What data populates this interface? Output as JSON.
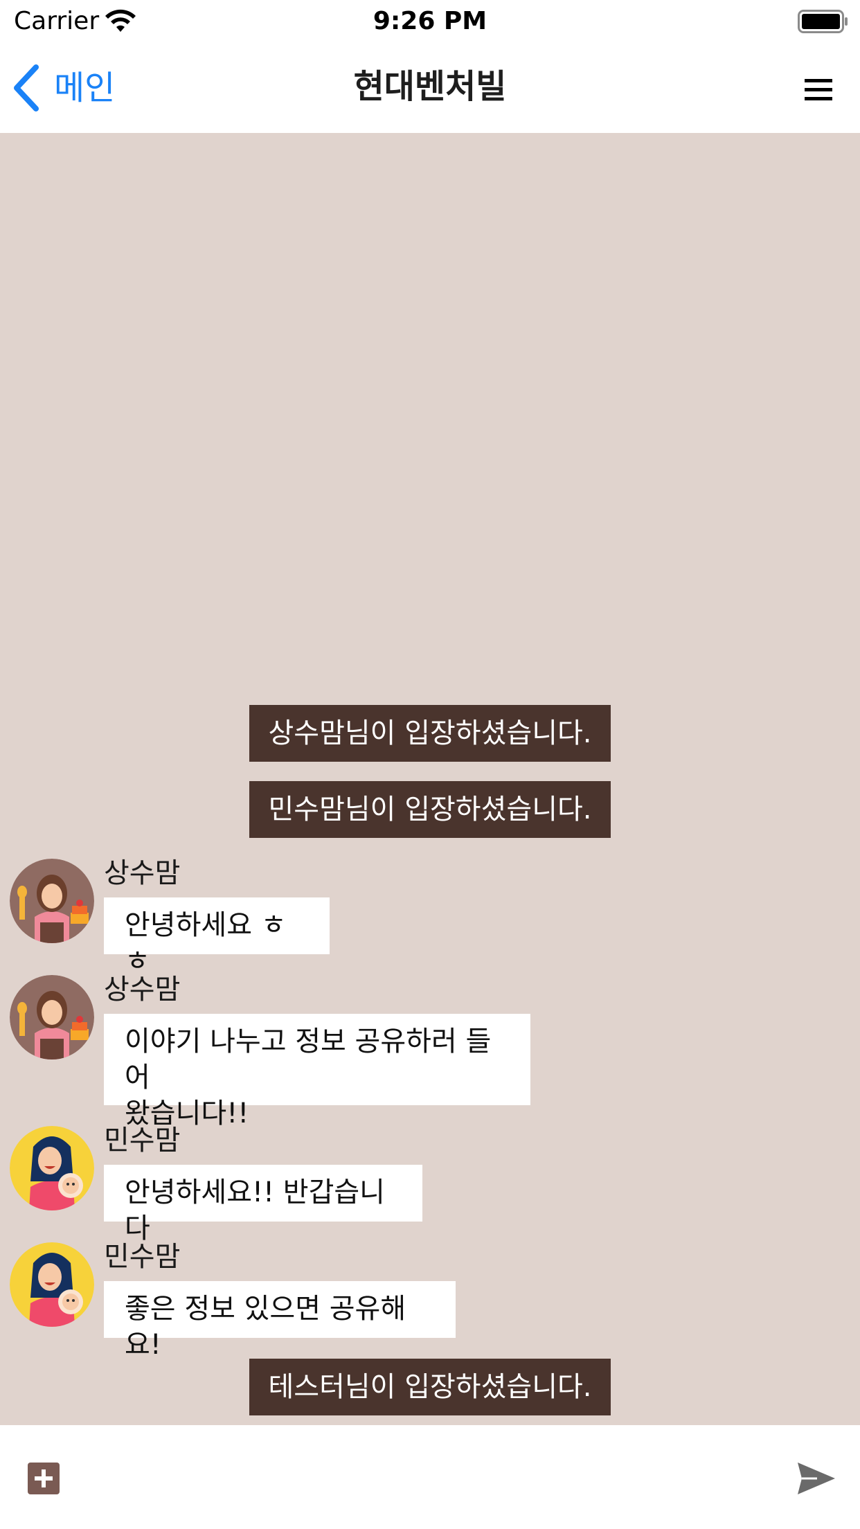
{
  "status_bar": {
    "carrier": "Carrier",
    "time": "9:26 PM"
  },
  "nav": {
    "back_label": "메인",
    "title": "현대벤처빌",
    "back_icon": "chevron-left-icon",
    "menu_icon": "hamburger-menu-icon",
    "accent_color": "#1a82f7"
  },
  "chat": {
    "background_color": "#e0d3cd",
    "system_bubble_color": "#4a342d",
    "messages": [
      {
        "kind": "system",
        "text": "상수맘님이 입장하셨습니다."
      },
      {
        "kind": "system",
        "text": "민수맘님이 입장하셨습니다."
      },
      {
        "kind": "user",
        "sender": "상수맘",
        "avatar": "mom-with-cake-avatar",
        "text": "안녕하세요 ㅎㅎ"
      },
      {
        "kind": "user",
        "sender": "상수맘",
        "avatar": "mom-with-cake-avatar",
        "text": "이야기 나누고 정보 공유하러 들어\n왔습니다!!"
      },
      {
        "kind": "user",
        "sender": "민수맘",
        "avatar": "mom-with-baby-avatar",
        "text": "안녕하세요!! 반갑습니다"
      },
      {
        "kind": "user",
        "sender": "민수맘",
        "avatar": "mom-with-baby-avatar",
        "text": "좋은 정보 있으면 공유해요!"
      },
      {
        "kind": "system",
        "text": "테스터님이 입장하셨습니다."
      }
    ]
  },
  "input_bar": {
    "placeholder": "",
    "add_icon": "plus-icon",
    "send_icon": "send-icon"
  }
}
